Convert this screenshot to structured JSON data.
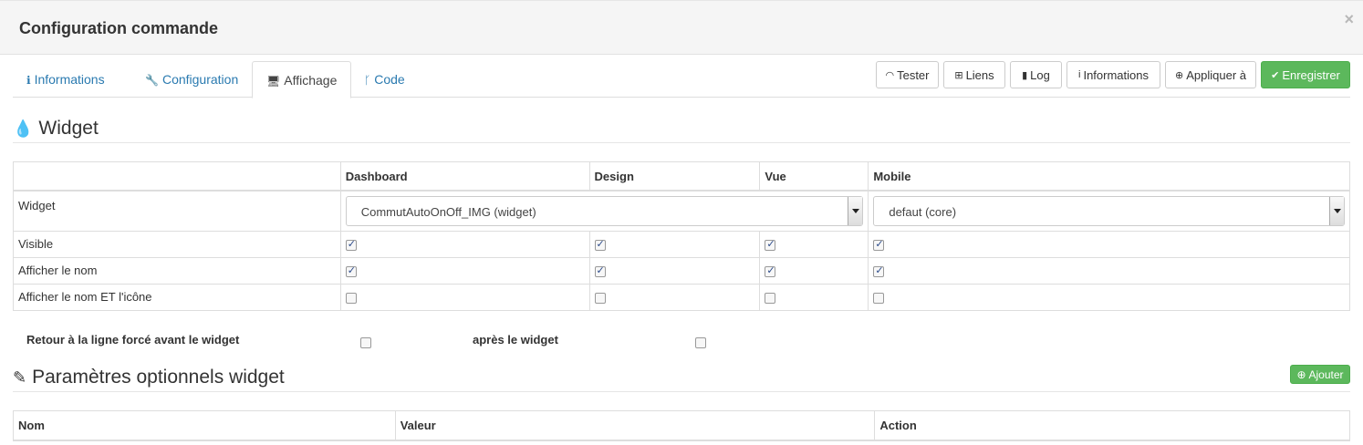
{
  "modal": {
    "title": "Configuration commande",
    "close_label": "×"
  },
  "tabs": [
    {
      "icon": "info-circle-icon",
      "label": "Informations"
    },
    {
      "icon": "wrench-icon",
      "label": "Configuration"
    },
    {
      "icon": "desktop-icon",
      "label": "Affichage",
      "active": true
    },
    {
      "icon": "code-branch-icon",
      "label": "Code"
    }
  ],
  "toolbar": {
    "tester": "Tester",
    "liens": "Liens",
    "log": "Log",
    "informations": "Informations",
    "appliquer": "Appliquer à",
    "enregistrer": "Enregistrer"
  },
  "widget_section": {
    "title": "Widget",
    "columns": [
      "",
      "Dashboard",
      "Design",
      "Vue",
      "Mobile"
    ],
    "widget_row_label": "Widget",
    "dashboard_select": "CommutAutoOnOff_IMG (widget)",
    "mobile_select": "defaut (core)",
    "rows": [
      {
        "label": "Visible",
        "checks": [
          true,
          true,
          true,
          true
        ]
      },
      {
        "label": "Afficher le nom",
        "checks": [
          true,
          true,
          true,
          true
        ]
      },
      {
        "label": "Afficher le nom ET l'icône",
        "checks": [
          false,
          false,
          false,
          false
        ]
      }
    ]
  },
  "line_break": {
    "before_label": "Retour à la ligne forcé avant le widget",
    "before_checked": false,
    "after_label": "après le widget",
    "after_checked": false
  },
  "params_section": {
    "title": "Paramètres optionnels widget",
    "add_label": "Ajouter",
    "columns": [
      "Nom",
      "Valeur",
      "Action"
    ]
  },
  "colors": {
    "accent": "#2a7ab0",
    "success": "#5cb85c"
  }
}
